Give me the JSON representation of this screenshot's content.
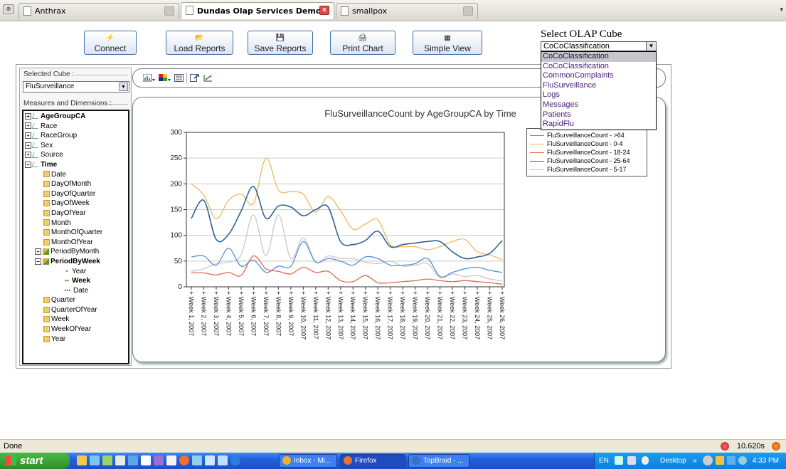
{
  "browser": {
    "tabs": [
      {
        "label": "Anthrax",
        "active": false
      },
      {
        "label": "Dundas Olap Services Demo",
        "active": true
      },
      {
        "label": "smallpox",
        "active": false
      }
    ],
    "tab_close_glyph": "x",
    "scroll_glyph": "▾"
  },
  "toolbar": {
    "connect": "Connect",
    "load_reports": "Load Reports",
    "save_reports": "Save Reports",
    "print_chart": "Print Chart",
    "simple_view": "Simple View"
  },
  "olap": {
    "title": "Select OLAP Cube",
    "selected": "CoCoClassification",
    "options": [
      "CoCoClassification",
      "CoCoClassification",
      "CommonComplaints",
      "FluSurveillance",
      "Logs",
      "Messages",
      "Patients",
      "RapidFlu"
    ],
    "highlighted_index": 0
  },
  "left_panel": {
    "selected_cube_label": "Selected Cube :",
    "selected_cube_value": "FluSurveillance",
    "measures_label": "Measures and Dimensions :",
    "tree": [
      {
        "label": "AgeGroupCA",
        "indent": 0,
        "exp": "+",
        "icon": "dim",
        "bold": true
      },
      {
        "label": "Race",
        "indent": 0,
        "exp": "+",
        "icon": "dim",
        "bold": false
      },
      {
        "label": "RaceGroup",
        "indent": 0,
        "exp": "+",
        "icon": "dim",
        "bold": false
      },
      {
        "label": "Sex",
        "indent": 0,
        "exp": "+",
        "icon": "dim",
        "bold": false
      },
      {
        "label": "Source",
        "indent": 0,
        "exp": "+",
        "icon": "dim",
        "bold": false
      },
      {
        "label": "Time",
        "indent": 0,
        "exp": "−",
        "icon": "dim",
        "bold": true
      },
      {
        "label": "Date",
        "indent": 1,
        "exp": "",
        "icon": "lvl",
        "bold": false
      },
      {
        "label": "DayOfMonth",
        "indent": 1,
        "exp": "",
        "icon": "lvl",
        "bold": false
      },
      {
        "label": "DayOfQuarter",
        "indent": 1,
        "exp": "",
        "icon": "lvl",
        "bold": false
      },
      {
        "label": "DayOfWeek",
        "indent": 1,
        "exp": "",
        "icon": "lvl",
        "bold": false
      },
      {
        "label": "DayOfYear",
        "indent": 1,
        "exp": "",
        "icon": "lvl",
        "bold": false
      },
      {
        "label": "Month",
        "indent": 1,
        "exp": "",
        "icon": "lvl",
        "bold": false
      },
      {
        "label": "MonthOfQuarter",
        "indent": 1,
        "exp": "",
        "icon": "lvl",
        "bold": false
      },
      {
        "label": "MonthOfYear",
        "indent": 1,
        "exp": "",
        "icon": "lvl",
        "bold": false
      },
      {
        "label": "PeriodByMonth",
        "indent": 1,
        "exp": "+",
        "icon": "hier",
        "bold": false
      },
      {
        "label": "PeriodByWeek",
        "indent": 1,
        "exp": "−",
        "icon": "hier",
        "bold": true
      },
      {
        "label": "Year",
        "indent": 2,
        "exp": "",
        "icon": "dot1",
        "bold": false
      },
      {
        "label": "Week",
        "indent": 2,
        "exp": "",
        "icon": "dot2",
        "bold": true
      },
      {
        "label": "Date",
        "indent": 2,
        "exp": "",
        "icon": "dot3",
        "bold": false
      },
      {
        "label": "Quarter",
        "indent": 1,
        "exp": "",
        "icon": "lvl",
        "bold": false
      },
      {
        "label": "QuarterOfYear",
        "indent": 1,
        "exp": "",
        "icon": "lvl",
        "bold": false
      },
      {
        "label": "Week",
        "indent": 1,
        "exp": "",
        "icon": "lvl",
        "bold": false
      },
      {
        "label": "WeekOfYear",
        "indent": 1,
        "exp": "",
        "icon": "lvl",
        "bold": false
      },
      {
        "label": "Year",
        "indent": 1,
        "exp": "",
        "icon": "lvl",
        "bold": false
      }
    ]
  },
  "chart_toolbar": {
    "icons": [
      "chart-type-icon",
      "palette-icon",
      "legend-icon",
      "export-icon",
      "axis-swap-icon"
    ]
  },
  "chart_data": {
    "type": "line",
    "title": "FluSurveillanceCount by AgeGroupCA by Time",
    "xlabel": "",
    "ylabel": "",
    "ylim": [
      0,
      300
    ],
    "yticks": [
      0,
      50,
      100,
      150,
      200,
      250,
      300
    ],
    "grid": true,
    "legend_position": "top-right",
    "categories": [
      "Week 1, 2007",
      "Week 2, 2007",
      "Week 3, 2007",
      "Week 4, 2007",
      "Week 5, 2007",
      "Week 6, 2007",
      "Week 7, 2007",
      "Week 8, 2007",
      "Week 9, 2007",
      "Week 10, 2007",
      "Week 11, 2007",
      "Week 12, 2007",
      "Week 13, 2007",
      "Week 14, 2007",
      "Week 15, 2007",
      "Week 16, 2007",
      "Week 17, 2007",
      "Week 18, 2007",
      "Week 19, 2007",
      "Week 20, 2007",
      "Week 21, 2007",
      "Week 22, 2007",
      "Week 23, 2007",
      "Week 24, 2007",
      "Week 25, 2007",
      "Week 26, 2007"
    ],
    "series": [
      {
        "name": "FluSurveillanceCount - >64",
        "color": "#5b8fd9",
        "values": [
          58,
          60,
          42,
          75,
          40,
          52,
          28,
          40,
          40,
          88,
          48,
          55,
          50,
          42,
          58,
          55,
          42,
          42,
          45,
          55,
          20,
          28,
          35,
          38,
          32,
          28
        ]
      },
      {
        "name": "FluSurveillanceCount - 0-4",
        "color": "#f0b860",
        "values": [
          200,
          178,
          132,
          168,
          180,
          162,
          250,
          188,
          185,
          180,
          145,
          175,
          148,
          112,
          122,
          130,
          82,
          78,
          78,
          72,
          78,
          88,
          92,
          68,
          62,
          53
        ]
      },
      {
        "name": "FluSurveillanceCount - 18-24",
        "color": "#e06a50",
        "values": [
          27,
          27,
          23,
          28,
          22,
          60,
          35,
          30,
          25,
          38,
          28,
          30,
          12,
          10,
          22,
          8,
          8,
          10,
          12,
          15,
          12,
          10,
          12,
          10,
          8,
          5
        ]
      },
      {
        "name": "FluSurveillanceCount - 25-64",
        "color": "#2e6494",
        "values": [
          133,
          168,
          92,
          102,
          147,
          195,
          133,
          157,
          155,
          138,
          150,
          155,
          88,
          82,
          90,
          108,
          78,
          82,
          85,
          88,
          88,
          68,
          55,
          58,
          65,
          90
        ]
      },
      {
        "name": "FluSurveillanceCount - 5-17",
        "color": "#c8c8c8",
        "values": [
          30,
          35,
          45,
          48,
          62,
          140,
          60,
          140,
          55,
          95,
          48,
          60,
          55,
          55,
          48,
          45,
          50,
          40,
          42,
          45,
          18,
          25,
          20,
          22,
          15,
          12
        ]
      }
    ]
  },
  "status": {
    "text": "Done",
    "timing": "10.620s"
  },
  "taskbar": {
    "start": "start",
    "tasks": [
      {
        "label": "Inbox - Mi...",
        "active": false,
        "color": "#f3b12a"
      },
      {
        "label": "Firefox",
        "active": true,
        "color": "#e8742a"
      },
      {
        "label": "TopBraid - ...",
        "active": false,
        "color": "#3a6fc8"
      }
    ],
    "lang": "EN",
    "desktop": "Desktop",
    "clock": "4:33 PM"
  }
}
